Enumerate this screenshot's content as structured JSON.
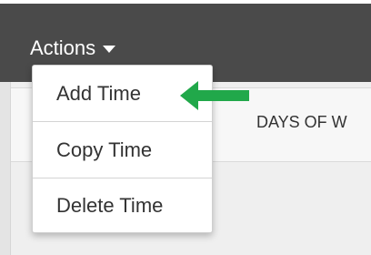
{
  "colors": {
    "toolbar_bg": "#4a4a4a",
    "menu_bg": "#ffffff",
    "pointer_arrow": "#21a84a"
  },
  "toolbar": {
    "actions_label": "Actions",
    "caret_icon": "caret-down-icon"
  },
  "actions_menu": {
    "items": [
      {
        "label": "Add Time"
      },
      {
        "label": "Copy Time"
      },
      {
        "label": "Delete Time"
      }
    ]
  },
  "table": {
    "column_header": "DAYS OF W"
  },
  "annotation": {
    "icon": "left-arrow-icon",
    "points_to": "Add Time"
  }
}
